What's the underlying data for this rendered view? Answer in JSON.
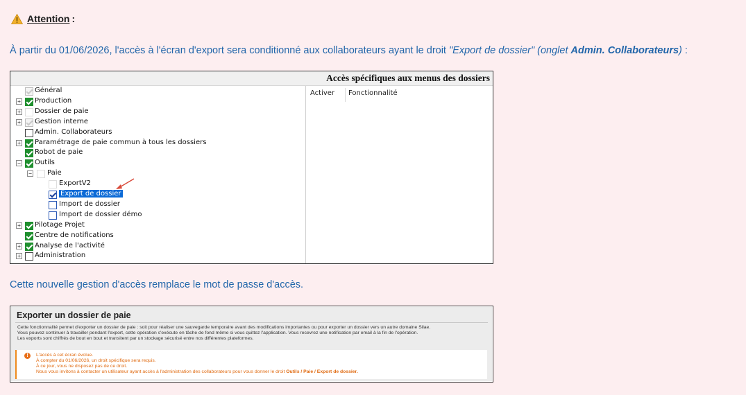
{
  "attention": {
    "icon": "warning-icon",
    "label": "Attention",
    "colon": ":"
  },
  "para1": {
    "text1": "À partir du 01/06/2026, l'accès à l'écran d'export sera conditionné aux collaborateurs ayant le droit ",
    "italic1": "\"Export de dossier\" (onglet ",
    "bold": "Admin. Collaborateurs",
    "italic2": ")",
    "text2": " :"
  },
  "rights_panel": {
    "title": "Accès spécifiques aux menus des dossiers",
    "columns": {
      "activer": "Activer",
      "fonctionnalite": "Fonctionnalité"
    },
    "tree": [
      {
        "label": "Général",
        "state": "grey",
        "expander": ""
      },
      {
        "label": "Production",
        "state": "checked",
        "expander": "+"
      },
      {
        "label": "Dossier de paie",
        "state": "empty-light",
        "expander": "+"
      },
      {
        "label": "Gestion interne",
        "state": "grey",
        "expander": "+"
      },
      {
        "label": "Admin. Collaborateurs",
        "state": "empty",
        "expander": ""
      },
      {
        "label": "Paramétrage de paie commun à tous les dossiers",
        "state": "checked",
        "expander": "+"
      },
      {
        "label": "Robot de paie",
        "state": "checked",
        "expander": ""
      },
      {
        "label": "Outils",
        "state": "checked",
        "expander": "−"
      },
      {
        "label": "Paie",
        "state": "empty-light",
        "expander": "−"
      },
      {
        "label": "ExportV2",
        "state": "empty-light",
        "expander": ""
      },
      {
        "label": "Export de dossier",
        "state": "blue-check",
        "expander": "",
        "selected": true
      },
      {
        "label": "Import de dossier",
        "state": "blue-empty",
        "expander": ""
      },
      {
        "label": "Import de dossier démo",
        "state": "blue-empty",
        "expander": ""
      },
      {
        "label": "Pilotage Projet",
        "state": "checked",
        "expander": "+"
      },
      {
        "label": "Centre de notifications",
        "state": "checked",
        "expander": ""
      },
      {
        "label": "Analyse de l'activité",
        "state": "checked",
        "expander": "+"
      },
      {
        "label": "Administration",
        "state": "empty",
        "expander": "+"
      }
    ]
  },
  "para2": {
    "text": "Cette nouvelle gestion d'accès remplace le mot de passe d'accès."
  },
  "export_panel": {
    "title": "Exporter un dossier de paie",
    "desc": [
      "Cette fonctionnalité permet d'exporter un dossier de paie : soit pour réaliser une sauvegarde temporaire avant des modifications importantes ou pour exporter un dossier vers un autre domaine Silae.",
      "Vous pouvez continuer à travailler pendant l'export, cette opération s'exécute en tâche de fond même si vous quittez l'application. Vous recevrez une notification par email à la fin de l'opération.",
      "Les exports sont chiffrés de bout en bout et transitent par un stockage sécurisé entre nos différentes plateformes."
    ],
    "warning": {
      "icon": "alert-circle-icon",
      "lines": [
        "L'accès à cet écran évolue.",
        "À compter du 01/06/2026, un droit spécifique sera requis.",
        "À ce jour, vous ne disposez pas de ce droit."
      ],
      "last_prefix": "Nous vous invitons à contacter un utilisateur ayant accès à l'administration des collaborateurs pour vous donner le droit ",
      "last_bold": "Outils / Paie / Export de dossier."
    }
  }
}
